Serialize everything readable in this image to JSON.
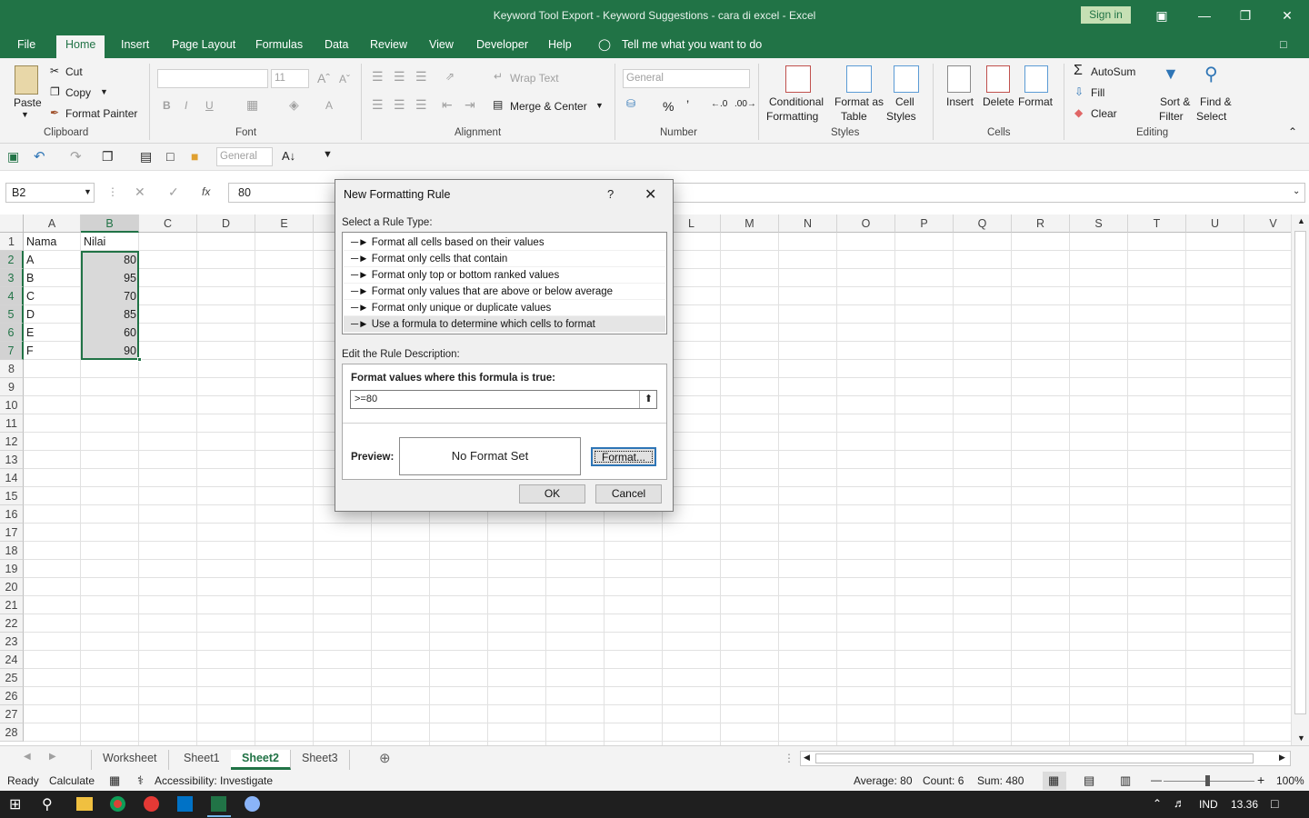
{
  "window": {
    "title": "Keyword Tool Export - Keyword Suggestions - cara di excel  -  Excel",
    "signin": "Sign in"
  },
  "tabs": [
    "File",
    "Home",
    "Insert",
    "Page Layout",
    "Formulas",
    "Data",
    "Review",
    "View",
    "Developer",
    "Help"
  ],
  "tell_me": "Tell me what you want to do",
  "ribbon": {
    "clipboard": {
      "paste": "Paste",
      "cut": "Cut",
      "copy": "Copy",
      "format_painter": "Format Painter",
      "label": "Clipboard"
    },
    "font": {
      "size": "11",
      "label": "Font"
    },
    "alignment": {
      "wrap": "Wrap Text",
      "merge": "Merge & Center",
      "label": "Alignment"
    },
    "number": {
      "format": "General",
      "label": "Number"
    },
    "styles": {
      "conditional": "Conditional",
      "formatting": "Formatting",
      "format_as": "Format as",
      "table": "Table",
      "cell": "Cell",
      "cell_styles": "Styles",
      "label": "Styles"
    },
    "cells": {
      "insert": "Insert",
      "delete": "Delete",
      "format": "Format",
      "label": "Cells"
    },
    "editing": {
      "autosum": "AutoSum",
      "fill": "Fill",
      "clear": "Clear",
      "sort": "Sort &",
      "filter": "Filter",
      "find": "Find &",
      "select": "Select",
      "label": "Editing"
    }
  },
  "qat": {
    "format": "General"
  },
  "formula_bar": {
    "name_box": "B2",
    "formula": "80",
    "fx": "fx"
  },
  "columns": [
    "A",
    "B",
    "C",
    "D",
    "E",
    "F",
    "G",
    "H",
    "I",
    "J",
    "K",
    "L",
    "M",
    "N",
    "O",
    "P",
    "Q",
    "R",
    "S",
    "T",
    "U",
    "V"
  ],
  "rows": [
    "1",
    "2",
    "3",
    "4",
    "5",
    "6",
    "7",
    "8",
    "9",
    "10",
    "11",
    "12",
    "13",
    "14",
    "15",
    "16",
    "17",
    "18",
    "19",
    "20",
    "21",
    "22",
    "23",
    "24",
    "25",
    "26",
    "27",
    "28"
  ],
  "cells": {
    "A1": "Nama",
    "B1": "Nilai",
    "A2": "A",
    "B2": "80",
    "A3": "B",
    "B3": "95",
    "A4": "C",
    "B4": "70",
    "A5": "D",
    "B5": "85",
    "A6": "E",
    "B6": "60",
    "A7": "F",
    "B7": "90"
  },
  "sheets": [
    "Worksheet",
    "Sheet1",
    "Sheet2",
    "Sheet3"
  ],
  "active_sheet": "Sheet2",
  "status": {
    "ready": "Ready",
    "calculate": "Calculate",
    "accessibility": "Accessibility: Investigate",
    "average": "Average: 80",
    "count": "Count: 6",
    "sum": "Sum: 480",
    "zoom": "100%"
  },
  "taskbar": {
    "lang": "IND",
    "time": "13.36"
  },
  "dialog": {
    "title": "New Formatting Rule",
    "help": "?",
    "select_label": "Select a Rule Type:",
    "rules": [
      "Format all cells based on their values",
      "Format only cells that contain",
      "Format only top or bottom ranked values",
      "Format only values that are above or below average",
      "Format only unique or duplicate values",
      "Use a formula to determine which cells to format"
    ],
    "selected_rule": 5,
    "edit_label": "Edit the Rule Description:",
    "formula_label": "Format values where this formula is true:",
    "formula_value": ">=80",
    "preview_label": "Preview:",
    "preview_text": "No Format Set",
    "format_button": "Format...",
    "ok": "OK",
    "cancel": "Cancel"
  }
}
